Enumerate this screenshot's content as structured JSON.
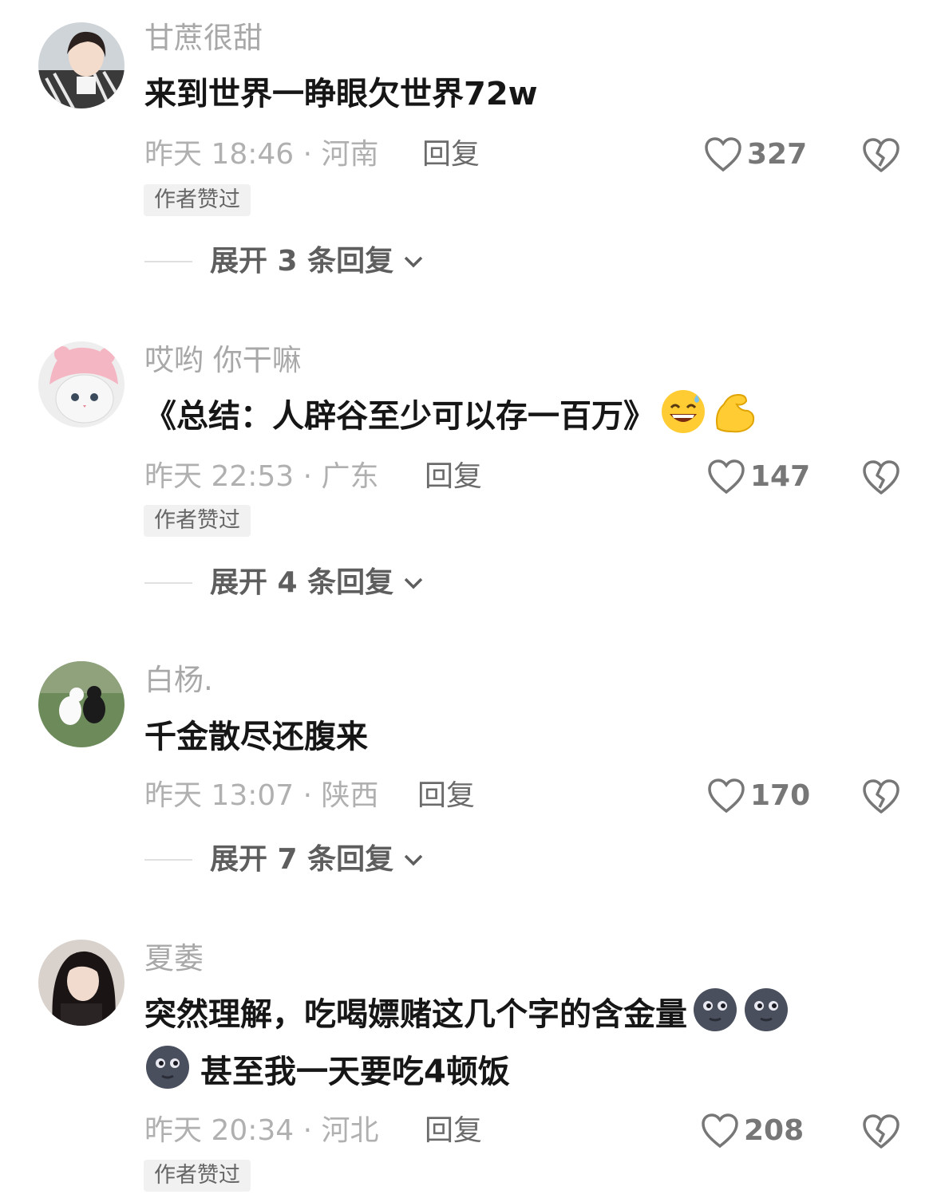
{
  "comments": [
    {
      "username": "甘蔗很甜",
      "text_lines": [
        "来到世界一睁眼欠世界72w"
      ],
      "time": "昨天 18:46 · 河南",
      "reply_label": "回复",
      "likes": "327",
      "badge": "作者赞过",
      "expand": "展开 3 条回复",
      "avatar_icon": "girl-portrait-avatar"
    },
    {
      "username": "哎哟 你干嘛",
      "text_lines": [
        "《总结：人辟谷至少可以存一百万》"
      ],
      "emojis": [
        "grinning-sweat-emoji",
        "flexed-biceps-emoji"
      ],
      "time": "昨天 22:53 · 广东",
      "reply_label": "回复",
      "likes": "147",
      "badge": "作者赞过",
      "expand": "展开 4 条回复",
      "avatar_icon": "cat-in-pink-hat-avatar"
    },
    {
      "username": "白杨.",
      "text_lines": [
        "千金散尽还腹来"
      ],
      "time": "昨天 13:07 · 陕西",
      "reply_label": "回复",
      "likes": "170",
      "expand": "展开 7 条回复",
      "avatar_icon": "two-cats-on-grass-avatar"
    },
    {
      "username": "夏萎",
      "text_lines": [
        "突然理解，吃喝嫖赌这几个字的含金量",
        "甚至我一天要吃4顿饭"
      ],
      "emojis": [
        "new-moon-face-emoji",
        "new-moon-face-emoji",
        "new-moon-face-emoji"
      ],
      "time": "昨天 20:34 · 河北",
      "reply_label": "回复",
      "likes": "208",
      "badge": "作者赞过",
      "avatar_icon": "woman-portrait-avatar"
    }
  ],
  "colors": {
    "username": "#a8a8a8",
    "text": "#161616",
    "badge_bg": "#f1f1f1",
    "reply": "#6b6b6b"
  }
}
